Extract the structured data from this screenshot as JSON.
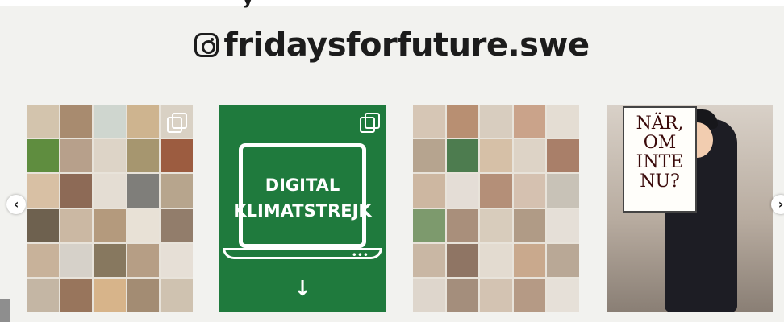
{
  "header": {
    "username": "fridaysforfuture.swe",
    "icon": "instagram-icon",
    "partial_title_text": "y"
  },
  "posts": [
    {
      "kind": "collage"
    },
    {
      "kind": "graphic",
      "line1": "DIGITAL",
      "line2": "KLIMATSTREJK",
      "download_icon": "↓"
    },
    {
      "kind": "collage"
    },
    {
      "kind": "photo",
      "sign_line1": "NÄR,",
      "sign_line2": "OM INTE",
      "sign_line3": "NU?"
    }
  ],
  "nav": {
    "prev_icon": "‹",
    "next_icon": "›"
  },
  "colors": {
    "brand_green": "#1f7a3d",
    "background": "#f2f2ef"
  }
}
